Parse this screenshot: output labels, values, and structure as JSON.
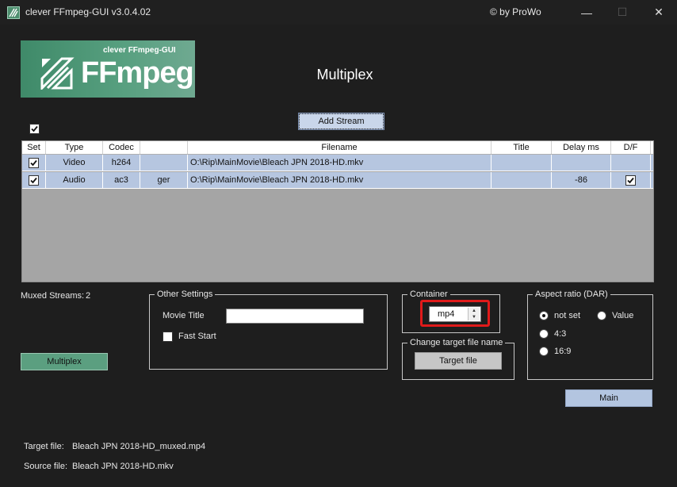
{
  "window": {
    "title": "clever FFmpeg-GUI v3.0.4.02",
    "copyright": "© by ProWo",
    "minimize_glyph": "—",
    "maximize_glyph": "☐",
    "close_glyph": "✕"
  },
  "logo": {
    "subtitle": "clever FFmpeg-GUI",
    "name": "FFmpeg"
  },
  "page": {
    "heading": "Multiplex"
  },
  "toolbar": {
    "select_all_checked": true,
    "add_stream_label": "Add Stream"
  },
  "streams": {
    "columns": [
      "Set",
      "Type",
      "Codec",
      "",
      "Filename",
      "Title",
      "Delay ms",
      "D/F"
    ],
    "rows": [
      {
        "set": true,
        "type": "Video",
        "codec": "h264",
        "lang": "",
        "filename": "O:\\Rip\\MainMovie\\Bleach JPN 2018-HD.mkv",
        "title": "",
        "delay": "",
        "df": false
      },
      {
        "set": true,
        "type": "Audio",
        "codec": "ac3",
        "lang": "ger",
        "filename": "O:\\Rip\\MainMovie\\Bleach JPN 2018-HD.mkv",
        "title": "",
        "delay": "-86",
        "df": true
      }
    ]
  },
  "muxed": {
    "label": "Muxed Streams:",
    "count": "2"
  },
  "other_settings": {
    "title": "Other Settings",
    "movie_title_label": "Movie Title",
    "movie_title_value": "",
    "fast_start_label": "Fast Start",
    "fast_start_checked": false
  },
  "container": {
    "title": "Container",
    "value": "mp4"
  },
  "change_target": {
    "title": "Change target file name",
    "button_label": "Target file"
  },
  "aspect": {
    "title": "Aspect ratio (DAR)",
    "options": [
      "not set",
      "Value",
      "4:3",
      "16:9"
    ],
    "selected": "not set"
  },
  "actions": {
    "multiplex_label": "Multiplex",
    "main_label": "Main"
  },
  "files": {
    "target_label": "Target file:",
    "target_value": "Bleach JPN 2018-HD_muxed.mp4",
    "source_label": "Source file:",
    "source_value": "Bleach JPN 2018-HD.mkv"
  },
  "colors": {
    "window_bg": "#1e1e1e",
    "logo_green": "#4e9878",
    "grid_bg": "#a5a5a5",
    "row_selected": "#b6c6e0",
    "highlight_red": "#e01a1a",
    "multiplex_button": "#5b9f80"
  }
}
